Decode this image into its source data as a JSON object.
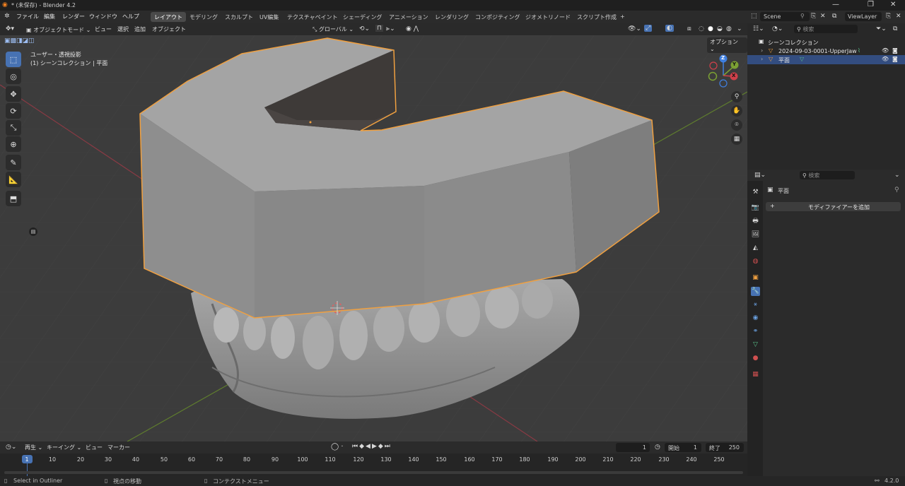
{
  "window": {
    "title": "* (未保存) - Blender 4.2",
    "minimize": "—",
    "restore": "❐",
    "close": "✕"
  },
  "menu": [
    "ファイル",
    "編集",
    "レンダー",
    "ウィンドウ",
    "ヘルプ"
  ],
  "workspaces": {
    "tabs": [
      "レイアウト",
      "モデリング",
      "スカルプト",
      "UV編集",
      "テクスチャペイント",
      "シェーディング",
      "アニメーション",
      "レンダリング",
      "コンポジティング",
      "ジオメトリノード",
      "スクリプト作成"
    ],
    "active": "レイアウト",
    "add": "+"
  },
  "scene": {
    "name": "Scene",
    "view_layer": "ViewLayer"
  },
  "viewport_header": {
    "mode": "オブジェクトモード",
    "menus": [
      "ビュー",
      "選択",
      "追加",
      "オブジェクト"
    ],
    "transform_orientation": "グローバル",
    "options": "オプション"
  },
  "viewport": {
    "view_name": "ユーザー・透視投影",
    "collection_info": "(1) シーンコレクション | 平面"
  },
  "gizmo": {
    "x": "X",
    "y": "Y",
    "z": "Z"
  },
  "outliner": {
    "search_placeholder": "検索",
    "root": "シーンコレクション",
    "items": [
      {
        "name": "2024-09-03-0001-UpperJaw",
        "selected": false
      },
      {
        "name": "平面",
        "selected": true
      }
    ]
  },
  "properties": {
    "search_placeholder": "検索",
    "object_name": "平面",
    "add_modifier": "モディファイアーを追加",
    "add_icon": "+"
  },
  "timeline": {
    "menus": [
      "再生",
      "キーイング",
      "ビュー",
      "マーカー"
    ],
    "current_frame": "1",
    "start_label": "開始",
    "start": "1",
    "end_label": "終了",
    "end": "250",
    "ticks": [
      "1",
      "10",
      "20",
      "30",
      "40",
      "50",
      "60",
      "70",
      "80",
      "90",
      "100",
      "110",
      "120",
      "130",
      "140",
      "150",
      "160",
      "170",
      "180",
      "190",
      "200",
      "210",
      "220",
      "230",
      "240",
      "250"
    ]
  },
  "statusbar": {
    "left": "Select in Outliner",
    "middle": "視点の移動",
    "right": "コンテクストメニュー",
    "version": "4.2.0"
  },
  "colors": {
    "accent": "#4772b3",
    "selection_outline": "#f0a040",
    "x_axis": "#b04050",
    "y_axis": "#7ba033",
    "z_axis": "#3f7fe0"
  }
}
